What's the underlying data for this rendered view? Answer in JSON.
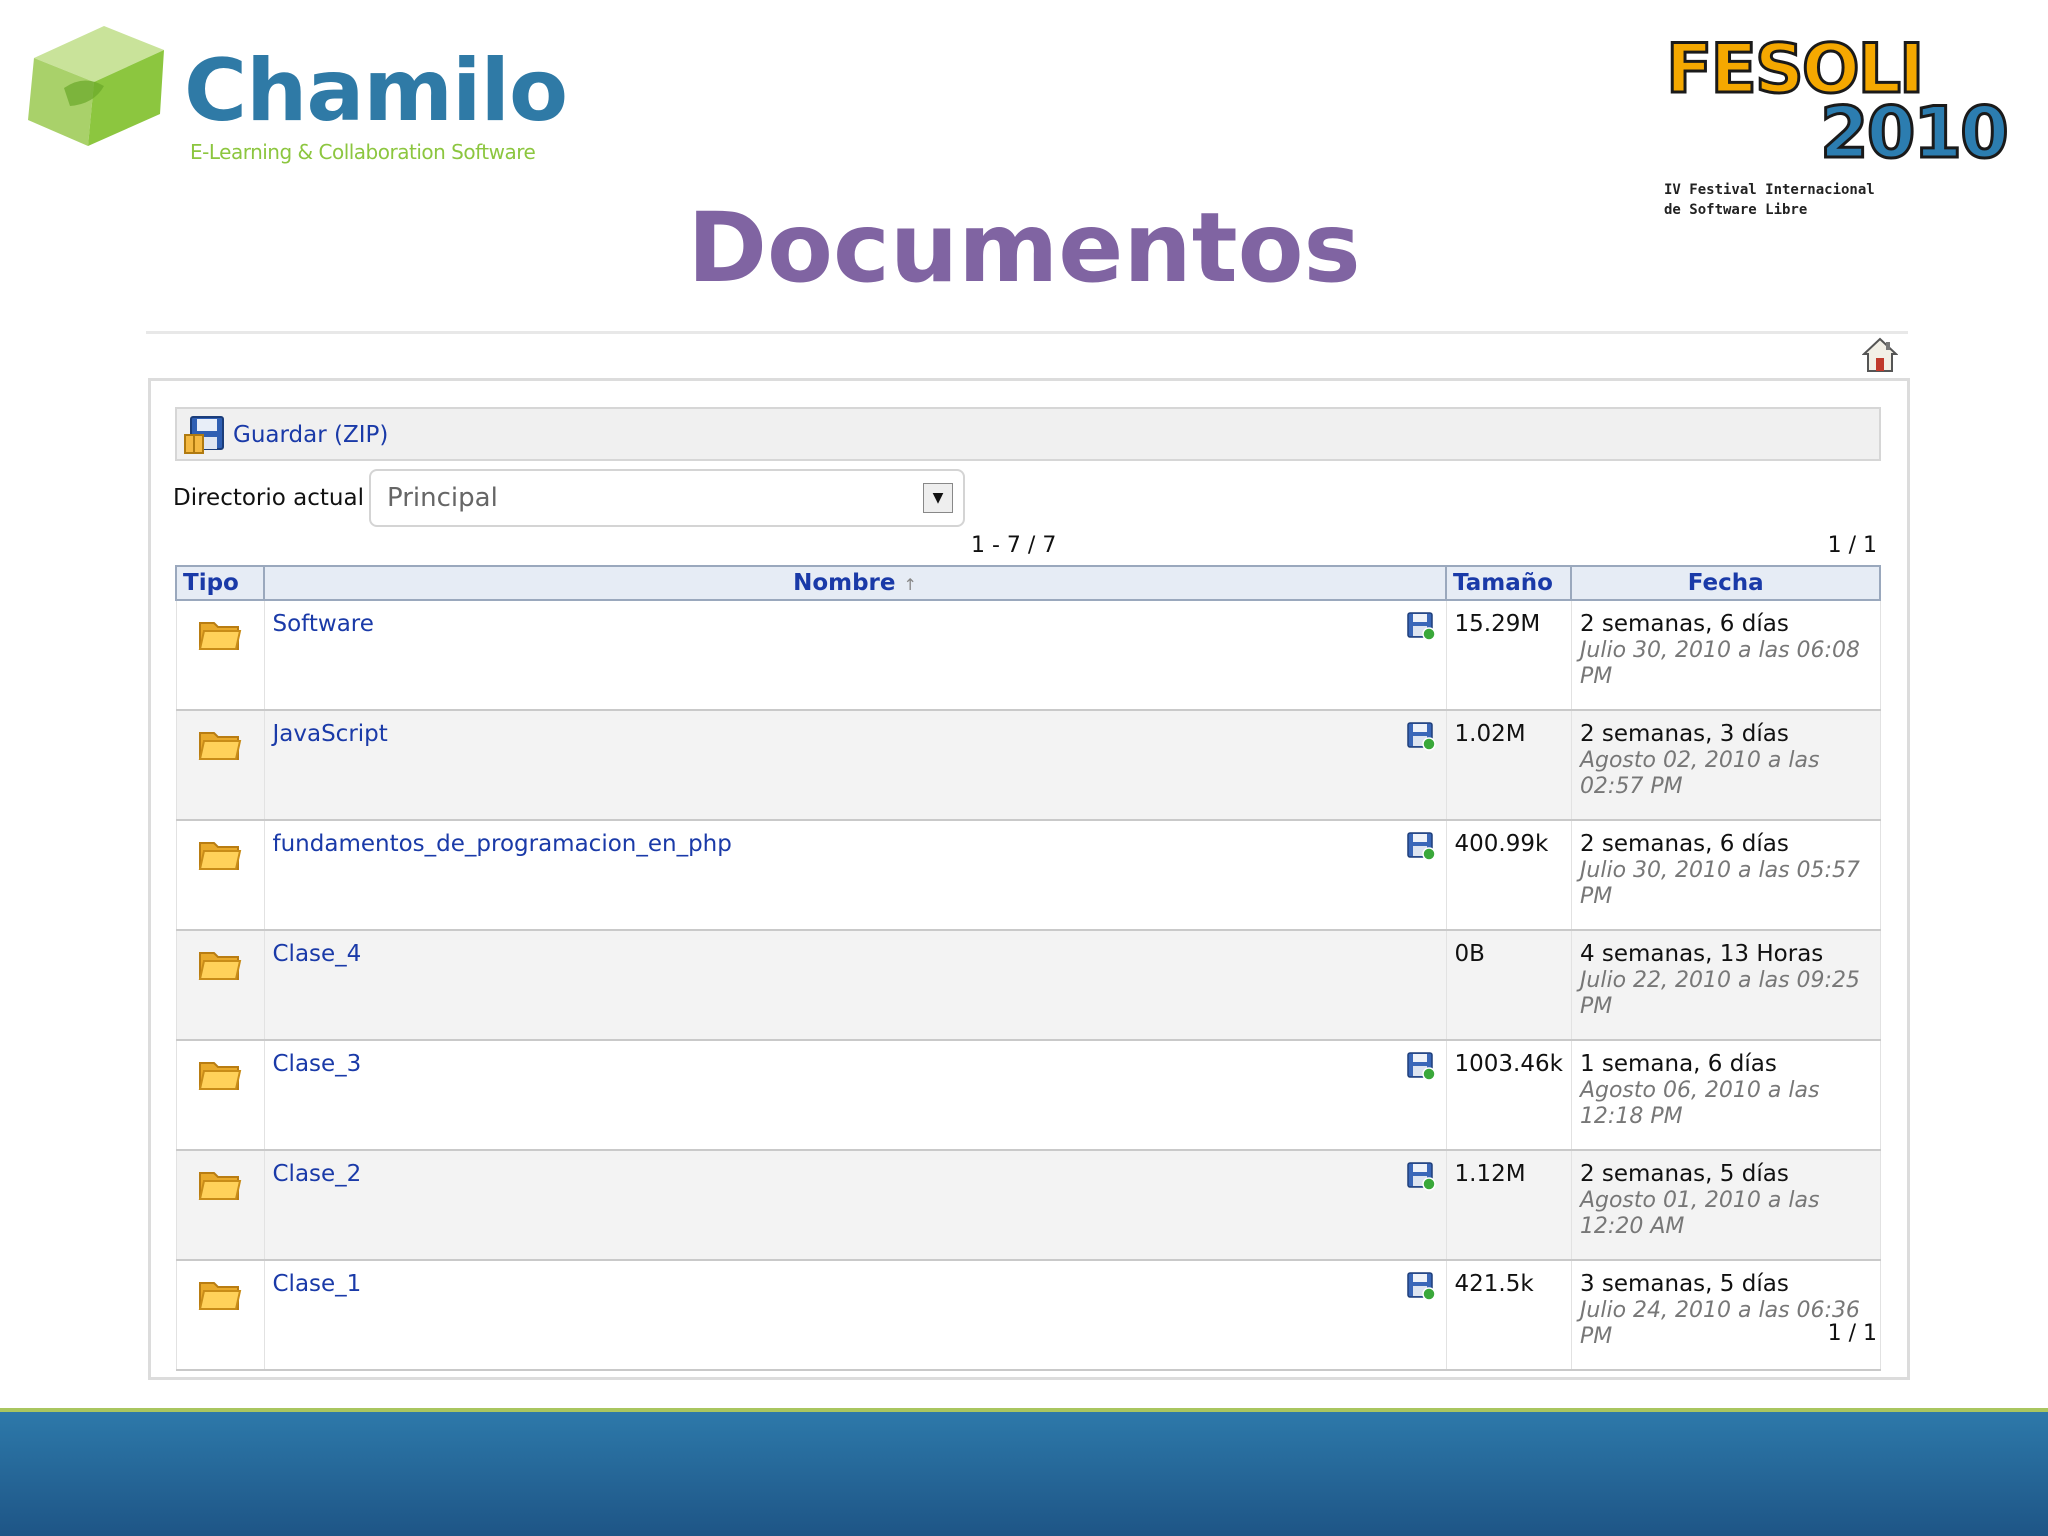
{
  "logos": {
    "chamilo": {
      "word": "Chamilo",
      "tagline": "E-Learning & Collaboration Software"
    },
    "fesoli": {
      "word": "FESOLI",
      "year": "2010",
      "subtitle_line1": "IV Festival Internacional",
      "subtitle_line2": "de Software Libre"
    }
  },
  "slide_title": "Documentos",
  "toolbar": {
    "zip_label": "Guardar (ZIP)"
  },
  "directory": {
    "label": "Directorio actual :",
    "value": "Principal"
  },
  "pager": {
    "range": "1 - 7 / 7",
    "page_top": "1 / 1",
    "page_bottom": "1 / 1"
  },
  "table": {
    "headers": {
      "tipo": "Tipo",
      "nombre": "Nombre",
      "tamano": "Tamaño",
      "fecha": "Fecha"
    },
    "sort_indicator": "↑",
    "rows": [
      {
        "name": "Software",
        "size": "15.29M",
        "ago": "2 semanas, 6 días",
        "date": "Julio 30, 2010 a las 06:08 PM",
        "downloadable": true
      },
      {
        "name": "JavaScript",
        "size": "1.02M",
        "ago": "2 semanas, 3 días",
        "date": "Agosto 02, 2010 a las 02:57 PM",
        "downloadable": true
      },
      {
        "name": "fundamentos_de_programacion_en_php",
        "size": "400.99k",
        "ago": "2 semanas, 6 días",
        "date": "Julio 30, 2010 a las 05:57 PM",
        "downloadable": true
      },
      {
        "name": "Clase_4",
        "size": "0B",
        "ago": "4 semanas, 13 Horas",
        "date": "Julio 22, 2010 a las 09:25 PM",
        "downloadable": false
      },
      {
        "name": "Clase_3",
        "size": "1003.46k",
        "ago": "1 semana, 6 días",
        "date": "Agosto 06, 2010 a las 12:18 PM",
        "downloadable": true
      },
      {
        "name": "Clase_2",
        "size": "1.12M",
        "ago": "2 semanas, 5 días",
        "date": "Agosto 01, 2010 a las 12:20 AM",
        "downloadable": true
      },
      {
        "name": "Clase_1",
        "size": "421.5k",
        "ago": "3 semanas, 5 días",
        "date": "Julio 24, 2010 a las 06:36 PM",
        "downloadable": true
      }
    ]
  },
  "icons": {
    "folder": "folder-icon",
    "download": "save-zip-icon",
    "home": "home-icon",
    "zip": "floppy-zip-icon"
  },
  "colors": {
    "title": "#8064a2",
    "link": "#1a3aa8",
    "band": "#2d79aa",
    "band_line": "#a9c65f"
  }
}
